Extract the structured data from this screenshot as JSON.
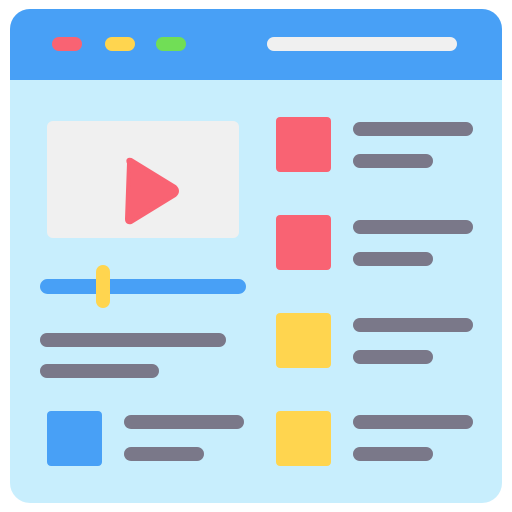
{
  "colors": {
    "frame": "#C8EEFD",
    "titlebar": "#48A0F6",
    "dot_close": "#F96373",
    "dot_minimize": "#FFD54F",
    "dot_maximize": "#71DE56",
    "address_bar": "#F0F0F0",
    "video_bg": "#F0F0F0",
    "play": "#F96373",
    "seek_track": "#48A0F6",
    "seek_handle": "#FFD54F",
    "text_line": "#7A7889",
    "thumb_red": "#F96373",
    "thumb_yellow": "#FFD54F",
    "thumb_blue": "#48A0F6"
  },
  "icons": {
    "play": "play-icon"
  },
  "player": {
    "progress_percent": 30
  },
  "list": {
    "items": [
      {
        "thumb_color": "#F96373"
      },
      {
        "thumb_color": "#F96373"
      },
      {
        "thumb_color": "#FFD54F"
      },
      {
        "thumb_color": "#FFD54F"
      }
    ]
  },
  "related": {
    "thumb_color": "#48A0F6"
  }
}
